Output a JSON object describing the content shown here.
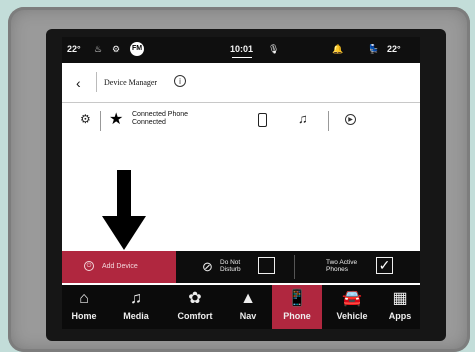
{
  "status": {
    "temp_left": "22°",
    "temp_right": "22°",
    "radio_badge": "FM",
    "clock": "10:01"
  },
  "header": {
    "back_symbol": "‹",
    "title": "Device Manager",
    "info_symbol": "i"
  },
  "device": {
    "name": "Connected Phone",
    "status": "Connected"
  },
  "options": {
    "add_device": "Add Device",
    "dnd_line1": "Do Not",
    "dnd_line2": "Disturb",
    "two_line1": "Two Active",
    "two_line2": "Phones",
    "dnd_checked": false,
    "two_checked": true
  },
  "nav": {
    "items": [
      {
        "label": "Home",
        "icon": "home-icon"
      },
      {
        "label": "Media",
        "icon": "music-note-icon"
      },
      {
        "label": "Comfort",
        "icon": "seat-fan-icon"
      },
      {
        "label": "Nav",
        "icon": "navigation-arrow-icon"
      },
      {
        "label": "Phone",
        "icon": "phone-icon"
      },
      {
        "label": "Vehicle",
        "icon": "car-icon"
      },
      {
        "label": "Apps",
        "icon": "grid-icon"
      }
    ],
    "active": "Phone"
  },
  "colors": {
    "accent": "#b0273f",
    "bar_bg": "#0d0d0d",
    "page_bg": "#c3ddd9"
  }
}
